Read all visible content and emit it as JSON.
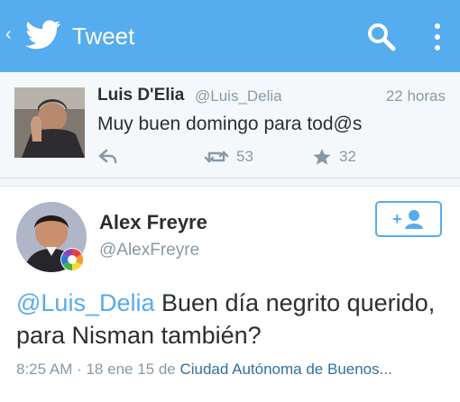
{
  "header": {
    "back_symbol": "‹",
    "title": "Tweet",
    "icons": [
      "twitter-bird-icon",
      "search-icon",
      "overflow-menu-icon"
    ]
  },
  "parent_tweet": {
    "name": "Luis D'Elia",
    "handle": "@Luis_Delia",
    "time": "22 horas",
    "text": "Muy buen domingo para tod@s",
    "retweets": "53",
    "favorites": "32"
  },
  "main_tweet": {
    "name": "Alex Freyre",
    "handle": "@AlexFreyre",
    "mention": "@Luis_Delia",
    "text": " Buen día negrito querido, para Nisman también?",
    "meta_time": "8:25 AM · 18 ene 15 de ",
    "meta_place": "Ciudad Autónoma de Buenos..."
  },
  "colors": {
    "twitter_blue": "#55acee",
    "text": "#292f33",
    "muted": "#8899a6"
  }
}
